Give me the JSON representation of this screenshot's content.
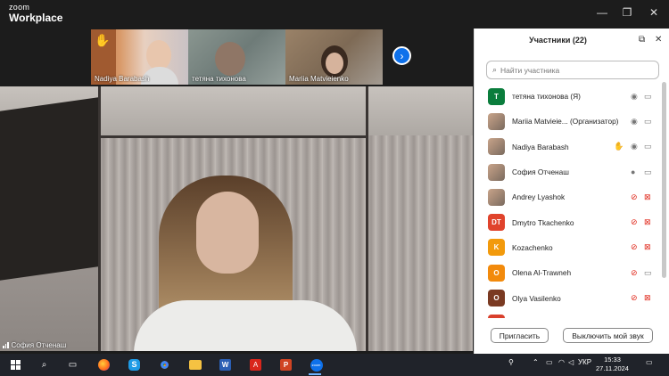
{
  "app": {
    "logo_line1": "zoom",
    "logo_line2": "Workplace"
  },
  "window_controls": {
    "minimize": "—",
    "maximize": "❐",
    "close": "✕"
  },
  "thumbnails": [
    {
      "name": "Nadiya Barabash",
      "raised_hand": true
    },
    {
      "name": "тетяна тихонова",
      "raised_hand": false
    },
    {
      "name": "Mariia Matvieienko",
      "raised_hand": false
    }
  ],
  "next_page_icon": "chevron-right-icon",
  "main_video": {
    "speaker_name": "София Отченаш"
  },
  "panel": {
    "title": "Участники (22)",
    "search_placeholder": "Найти участника",
    "participants": [
      {
        "name": "тетяна тихонова (Я)",
        "avatar_text": "T",
        "avatar_color": "#0a7d3c",
        "mic": "on",
        "video": "on",
        "hand": false
      },
      {
        "name": "Mariia Matvieie... (Организатор)",
        "avatar_text": "",
        "avatar_color": "photo",
        "mic": "on",
        "video": "on",
        "hand": false
      },
      {
        "name": "Nadiya Barabash",
        "avatar_text": "",
        "avatar_color": "photo",
        "mic": "on",
        "video": "on",
        "hand": true
      },
      {
        "name": "София Отченаш",
        "avatar_text": "",
        "avatar_color": "photo",
        "mic": "active",
        "video": "on",
        "hand": false
      },
      {
        "name": "Andrey Lyashok",
        "avatar_text": "",
        "avatar_color": "photo",
        "mic": "muted",
        "video": "off",
        "hand": false
      },
      {
        "name": "Dmytro Tkachenko",
        "avatar_text": "DT",
        "avatar_color": "#e0432c",
        "mic": "muted",
        "video": "off",
        "hand": false
      },
      {
        "name": "Kozachenko",
        "avatar_text": "K",
        "avatar_color": "#f29a0c",
        "mic": "muted",
        "video": "off",
        "hand": false
      },
      {
        "name": "Olena Al-Trawneh",
        "avatar_text": "O",
        "avatar_color": "#f28a0c",
        "mic": "muted",
        "video": "on",
        "hand": false
      },
      {
        "name": "Olya Vasilenko",
        "avatar_text": "O",
        "avatar_color": "#7a3a22",
        "mic": "muted",
        "video": "off",
        "hand": false
      },
      {
        "name": "",
        "avatar_text": "",
        "avatar_color": "#d9402c",
        "mic": "muted",
        "video": "off",
        "hand": false
      }
    ],
    "invite_label": "Пригласить",
    "mute_label": "Выключить мой звук"
  },
  "taskbar": {
    "language": "УКР",
    "time": "15:33",
    "date": "27.11.2024"
  },
  "colors": {
    "accent": "#0e71eb",
    "muted_red": "#e0271a"
  }
}
